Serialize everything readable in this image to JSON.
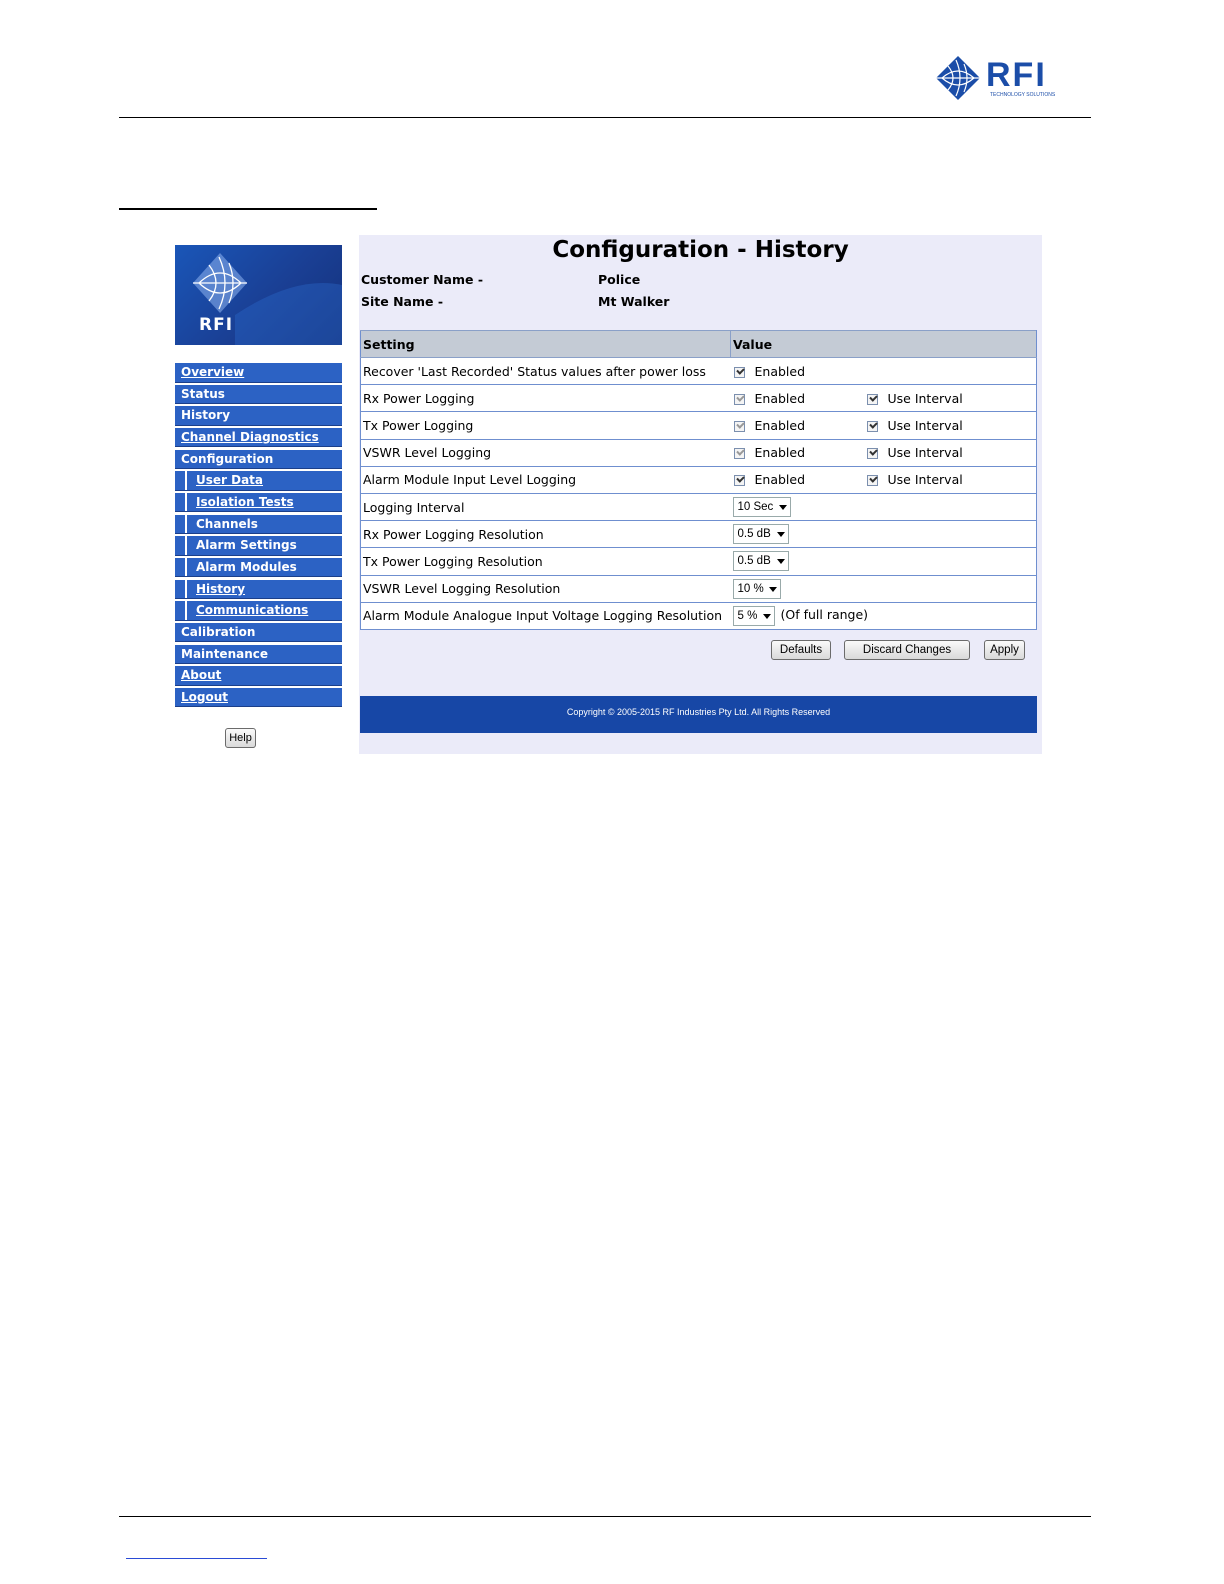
{
  "brand": {
    "name": "RFI",
    "tagline": "TECHNOLOGY SOLUTIONS"
  },
  "sidebar": {
    "logo_text": "RFI",
    "items": [
      {
        "label": "Overview"
      },
      {
        "label": "Status"
      },
      {
        "label": "History"
      },
      {
        "label": "Channel Diagnostics"
      },
      {
        "label": "Configuration"
      },
      {
        "label": "User Data"
      },
      {
        "label": "Isolation Tests"
      },
      {
        "label": "Channels"
      },
      {
        "label": "Alarm Settings"
      },
      {
        "label": "Alarm Modules"
      },
      {
        "label": "History"
      },
      {
        "label": "Communications"
      },
      {
        "label": "Calibration"
      },
      {
        "label": "Maintenance"
      },
      {
        "label": "About"
      },
      {
        "label": "Logout"
      }
    ],
    "help_label": "Help"
  },
  "main": {
    "title": "Configuration - History",
    "customer_label": "Customer Name -",
    "customer_value": "Police",
    "site_label": "Site Name -",
    "site_value": "Mt Walker",
    "table": {
      "headers": {
        "setting": "Setting",
        "value": "Value"
      },
      "enabled_label": "Enabled",
      "use_interval_label": "Use Interval",
      "rows": [
        {
          "setting": "Recover 'Last Recorded' Status values after power loss"
        },
        {
          "setting": "Rx Power Logging"
        },
        {
          "setting": "Tx Power Logging"
        },
        {
          "setting": "VSWR Level Logging"
        },
        {
          "setting": "Alarm Module Input Level Logging"
        },
        {
          "setting": "Logging Interval",
          "value": "10 Sec"
        },
        {
          "setting": "Rx Power Logging Resolution",
          "value": "0.5 dB"
        },
        {
          "setting": "Tx Power Logging Resolution",
          "value": "0.5 dB"
        },
        {
          "setting": "VSWR Level Logging Resolution",
          "value": "10 %"
        },
        {
          "setting": "Alarm Module Analogue Input Voltage Logging Resolution",
          "value": "5 %",
          "suffix": "(Of full range)"
        }
      ]
    },
    "buttons": {
      "defaults": "Defaults",
      "discard": "Discard Changes",
      "apply": "Apply"
    },
    "footer": "Copyright © 2005-2015 RF Industries Pty Ltd. All Rights Reserved"
  }
}
